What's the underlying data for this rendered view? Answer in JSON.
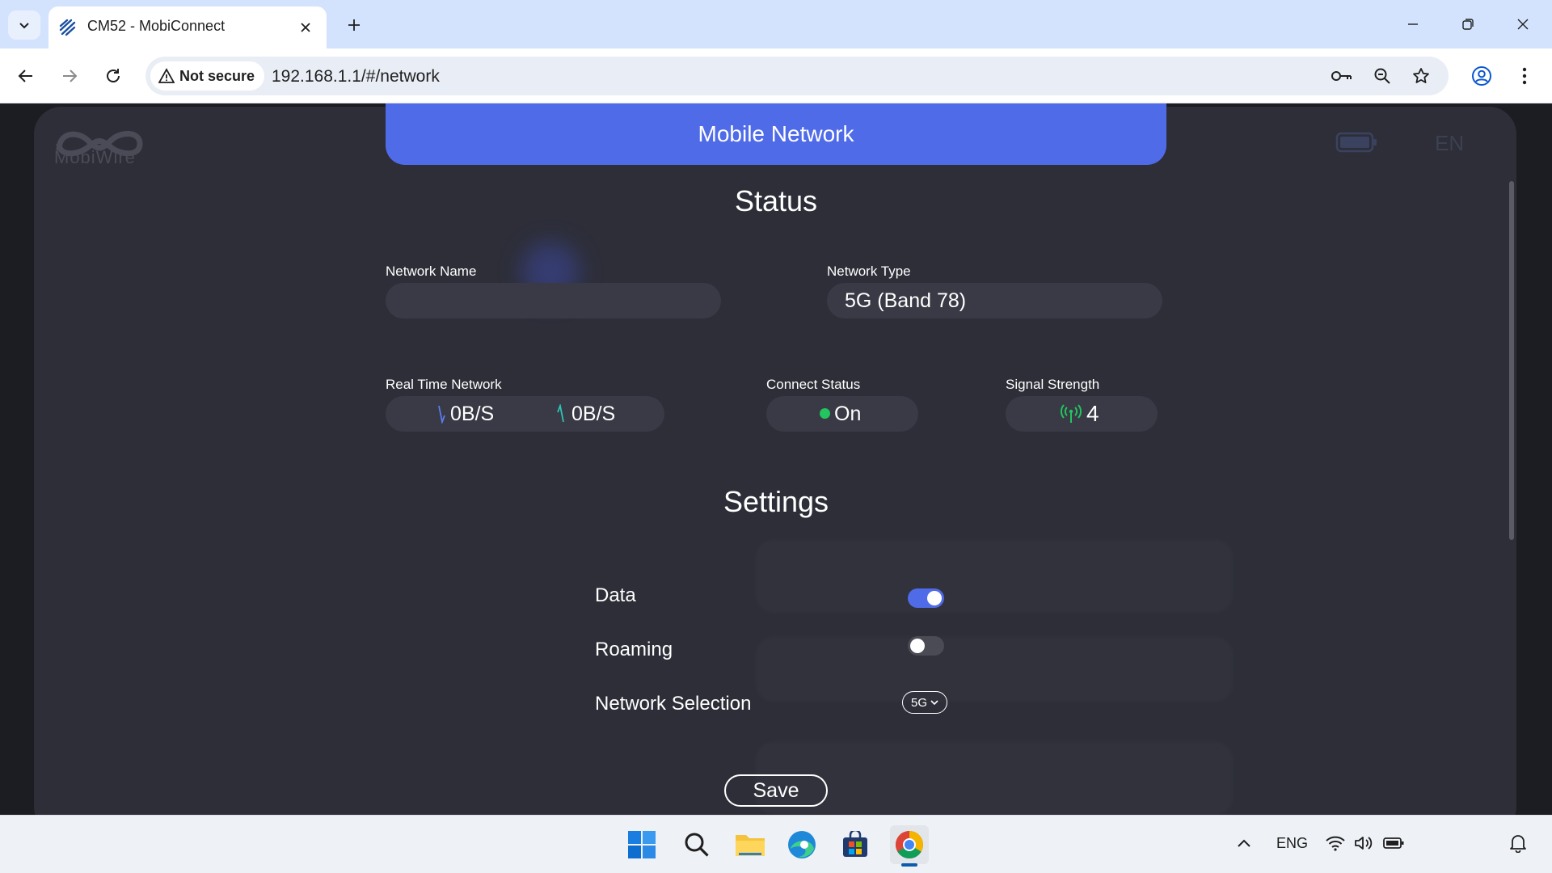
{
  "browser": {
    "tab_title": "CM52 - MobiConnect",
    "security_label": "Not secure",
    "url": "192.168.1.1/#/network"
  },
  "app": {
    "logo_text": "MobiWire",
    "language": "EN",
    "header_title": "Mobile Network",
    "status": {
      "title": "Status",
      "network_name_label": "Network Name",
      "network_name_value": "",
      "network_type_label": "Network Type",
      "network_type_value": "5G (Band 78)",
      "realtime_label": "Real Time Network",
      "download_value": "0B/S",
      "upload_value": "0B/S",
      "connect_status_label": "Connect Status",
      "connect_status_value": "On",
      "signal_label": "Signal Strength",
      "signal_value": "4"
    },
    "settings": {
      "title": "Settings",
      "data_label": "Data",
      "data_enabled": true,
      "roaming_label": "Roaming",
      "roaming_enabled": false,
      "network_selection_label": "Network Selection",
      "network_selection_value": "5G",
      "save_label": "Save"
    }
  },
  "taskbar": {
    "language": "ENG"
  },
  "colors": {
    "accent": "#4f6be8",
    "status_on": "#22c55e",
    "panel_bg": "#2d2e38",
    "field_bg": "#393a45"
  }
}
